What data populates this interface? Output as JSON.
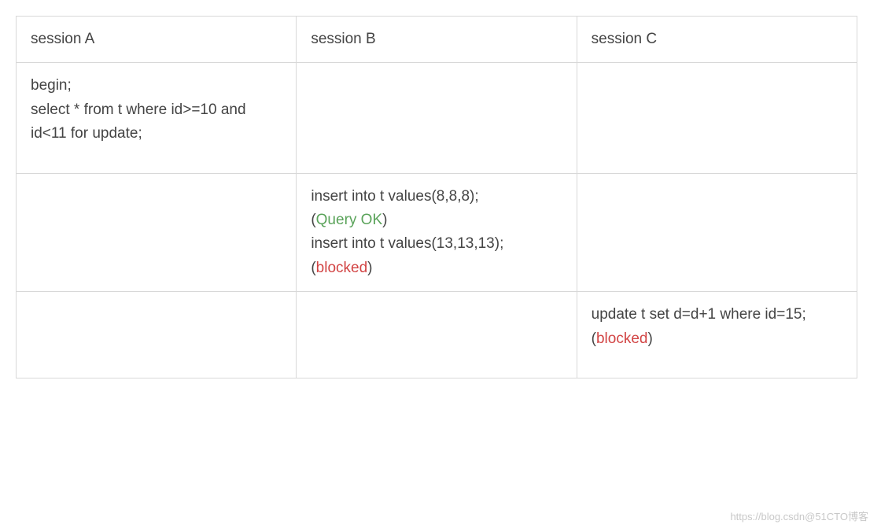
{
  "table": {
    "headers": [
      "session A",
      "session B",
      "session C"
    ],
    "rows": [
      {
        "a": "begin;\nselect * from t where id>=10 and id<11 for update;",
        "b": "",
        "c": ""
      },
      {
        "a": "",
        "b": {
          "line1": "insert into t values(8,8,8);",
          "paren_open1": "(",
          "status1": "Query OK",
          "paren_close1": ")",
          "line2": "insert into t values(13,13,13);",
          "paren_open2": "(",
          "status2": "blocked",
          "paren_close2": ")"
        },
        "c": ""
      },
      {
        "a": "",
        "b": "",
        "c": {
          "line1": "update t set d=d+1 where id=15;",
          "paren_open1": "(",
          "status1": "blocked",
          "paren_close1": ")"
        }
      }
    ]
  },
  "watermark": "https://blog.csdn@51CTO博客"
}
